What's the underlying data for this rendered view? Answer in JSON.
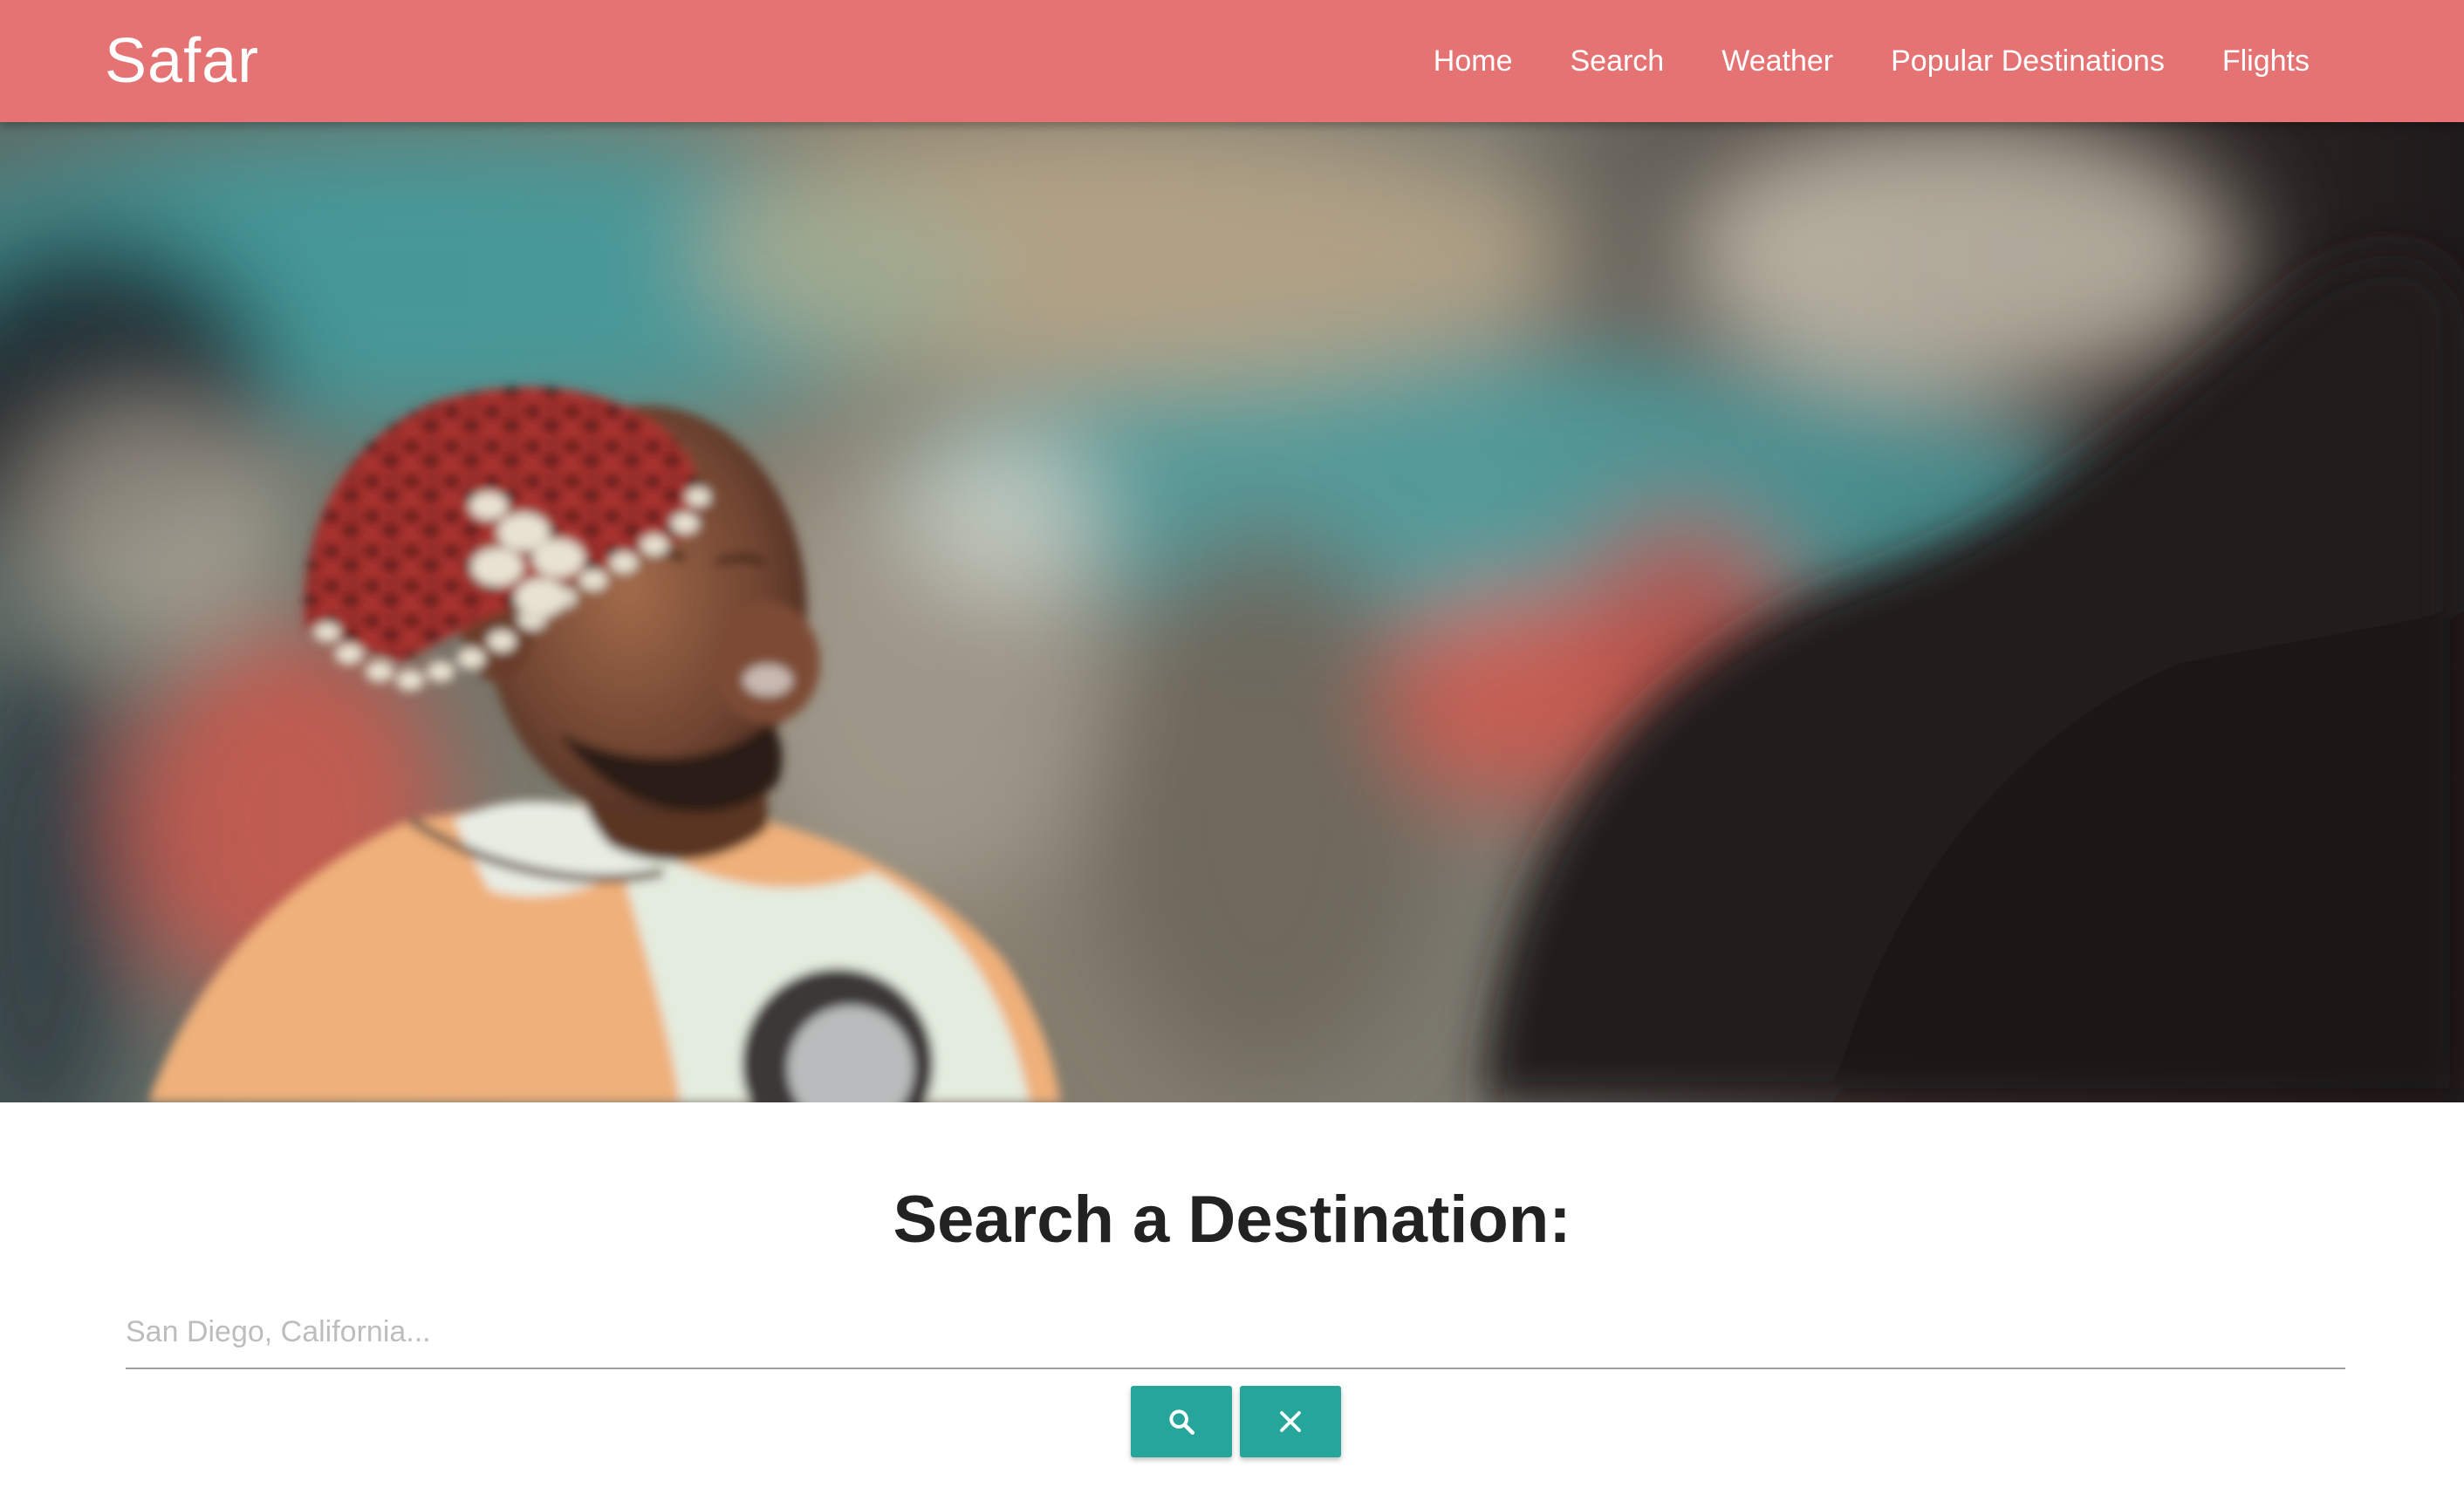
{
  "navbar": {
    "brand": "Safar",
    "background_color": "#e57373",
    "links": [
      {
        "label": "Home"
      },
      {
        "label": "Search"
      },
      {
        "label": "Weather"
      },
      {
        "label": "Popular Destinations"
      },
      {
        "label": "Flights"
      }
    ]
  },
  "hero": {
    "image_description_icon": "hero-photo"
  },
  "search": {
    "title": "Search a Destination:",
    "input_value": "",
    "placeholder": "San Diego, California...",
    "search_button_icon": "search-icon",
    "clear_button_icon": "close-icon",
    "button_color": "#26a69a"
  }
}
